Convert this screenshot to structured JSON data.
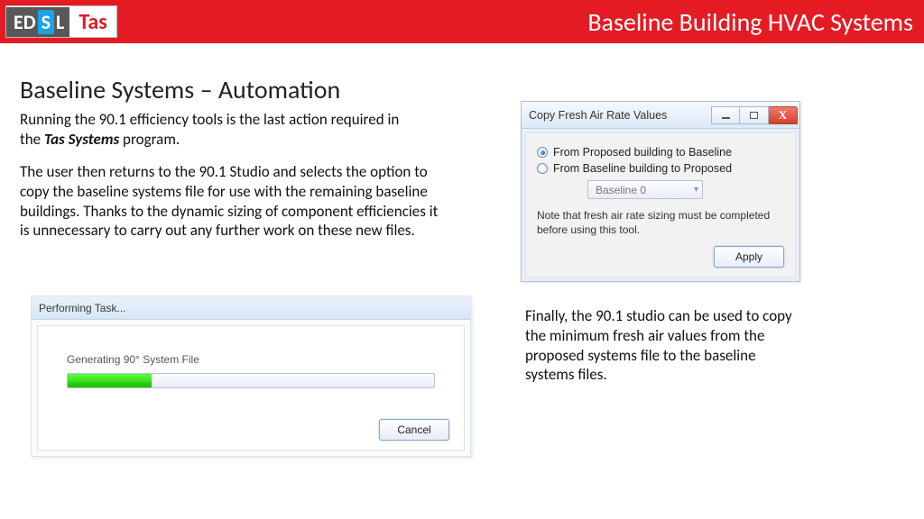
{
  "topbar": {
    "logo": {
      "ed": "ED",
      "s": "S",
      "l": "L",
      "tas": "Tas"
    },
    "title": "Baseline Building HVAC Systems"
  },
  "heading": "Baseline Systems – Automation",
  "para1_a": "Running the 90.1 efficiency tools is the last action required in the ",
  "para1_bold": "Tas Systems",
  "para1_b": " program.",
  "para2": "The user then returns to the 90.1 Studio and selects the option to copy the baseline systems file for use with the remaining baseline buildings. Thanks to the dynamic sizing of component efficiencies it is unnecessary to carry out any further work on these new files.",
  "para3": "Finally, the 90.1 studio can be used to copy the minimum fresh air values from the proposed systems file to the baseline systems files.",
  "dlg1": {
    "title": "Performing Task...",
    "message": "Generating 90° System File",
    "cancel": "Cancel"
  },
  "dlg2": {
    "title": "Copy Fresh Air Rate Values",
    "opt1": "From Proposed building to Baseline",
    "opt2": "From Baseline building to Proposed",
    "select": "Baseline 0",
    "note": "Note that fresh air rate sizing must be completed before using this tool.",
    "apply": "Apply",
    "close_glyph": "X"
  }
}
